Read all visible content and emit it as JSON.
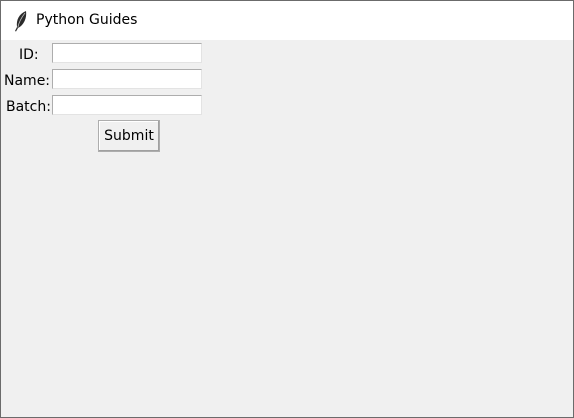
{
  "window": {
    "title": "Python Guides",
    "icon": "feather-icon"
  },
  "form": {
    "id_label": "ID:",
    "id_value": "",
    "name_label": "Name:",
    "name_value": "",
    "batch_label": "Batch:",
    "batch_value": "",
    "submit_label": "Submit"
  }
}
